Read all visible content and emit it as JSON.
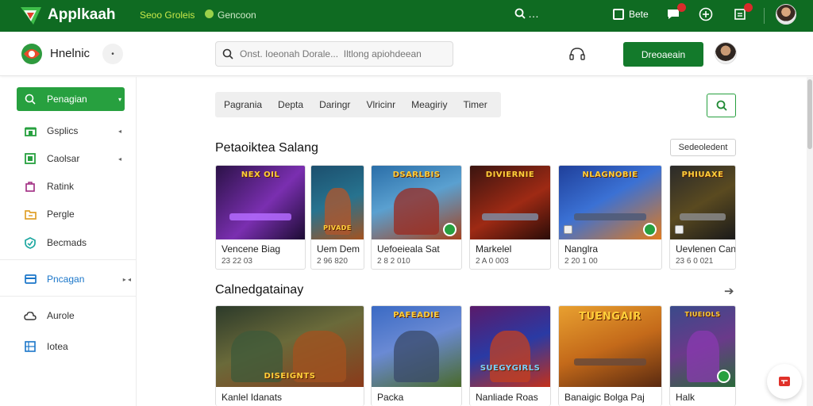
{
  "topbar": {
    "app_title": "Applkaah",
    "link1": "Seoo Groleis",
    "link2": "Gencoon",
    "search_label": "…",
    "calendar_label": "Bete",
    "bg_color": "#0f6b22"
  },
  "subhead": {
    "title": "Hnelnic",
    "search_placeholder": "Onst. Ioeonah Dorale...  Iltlong apiohdeean",
    "cta_label": "Dreoaeain",
    "accent": "#137a2b"
  },
  "sidebar": {
    "items": [
      {
        "label": "Penagian",
        "icon": "search-icon",
        "active": true
      },
      {
        "label": "Gsplics",
        "icon": "store-icon"
      },
      {
        "label": "Caolsar",
        "icon": "box-icon"
      },
      {
        "label": "Ratink",
        "icon": "bag-icon"
      },
      {
        "label": "Pergle",
        "icon": "folder-icon"
      },
      {
        "label": "Becmads",
        "icon": "shield-icon"
      },
      {
        "label": "Pncagan",
        "icon": "card-icon"
      },
      {
        "label": "Aurole",
        "icon": "cloud-icon"
      },
      {
        "label": "Iotea",
        "icon": "grid-icon"
      }
    ]
  },
  "filters": {
    "tabs": [
      "Pagrania",
      "Depta",
      "Daringr",
      "Vlricinr",
      "Meagiriy",
      "Timer"
    ]
  },
  "section1": {
    "title": "Petaoiktea Salang",
    "button_label": "Sedeoledent",
    "cards": [
      {
        "name": "Vencene Biag",
        "meta": "23 22 03",
        "art": "NEX OIL"
      },
      {
        "name": "Uem Dem",
        "meta": "2 96 820",
        "art": "PIVADE"
      },
      {
        "name": "Uefoeieala Sat",
        "meta": "2 8 2 010",
        "art": "DSARLBIS"
      },
      {
        "name": "Markelel",
        "meta": "2 A 0 003",
        "art": "DIVIERNIE"
      },
      {
        "name": "Nanglra",
        "meta": "2 20 1 00",
        "art": "NLAGNOBIE"
      },
      {
        "name": "Uevlenen Cand",
        "meta": "23 6 0 021",
        "art": "PHIUAXE"
      }
    ]
  },
  "section2": {
    "title": "Calnedgatainay",
    "cards": [
      {
        "name": "Kanlel Idanats",
        "art": "DISEIGNTS"
      },
      {
        "name": "Packa",
        "art": "PAFEADIE"
      },
      {
        "name": "Nanliade Roas",
        "art": "SUEGYGIRLS"
      },
      {
        "name": "Banaigic Bolga Paj",
        "art": "TUENGAIR"
      },
      {
        "name": "Halk",
        "art": "TIUEIOLS"
      }
    ]
  }
}
